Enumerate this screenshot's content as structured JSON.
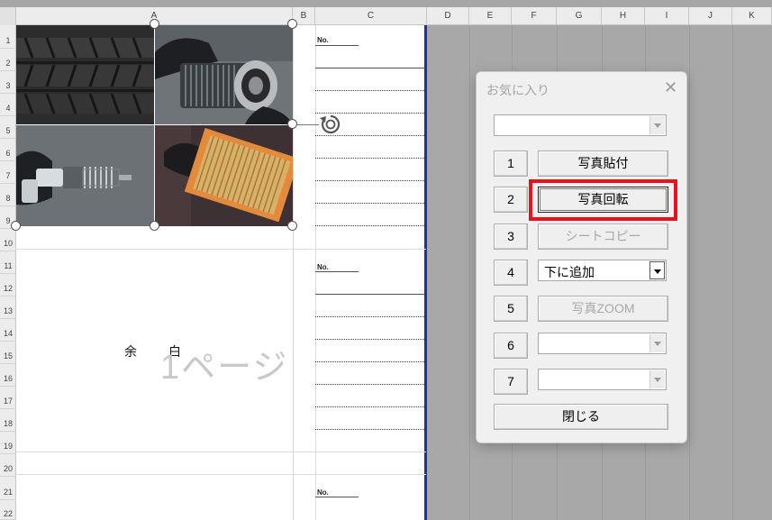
{
  "spreadsheet": {
    "columns": [
      "A",
      "B",
      "C",
      "D",
      "E",
      "F",
      "G",
      "H",
      "I",
      "J",
      "K"
    ],
    "rows": [
      "1",
      "2",
      "3",
      "4",
      "5",
      "6",
      "7",
      "8",
      "9",
      "10",
      "11",
      "12",
      "13",
      "14",
      "15",
      "16",
      "17",
      "18",
      "19",
      "20",
      "21",
      "22"
    ],
    "no_labels": [
      "No.",
      "No.",
      "No."
    ],
    "memo_chars": [
      "余",
      "白"
    ],
    "page_watermark": "1ページ"
  },
  "dialog": {
    "title": "お気に入り",
    "close_icon": "close-icon",
    "top_combo_value": "",
    "rows": [
      {
        "num": "1",
        "kind": "button",
        "label": "写真貼付",
        "enabled": true
      },
      {
        "num": "2",
        "kind": "button",
        "label": "写真回転",
        "enabled": true,
        "focused": true
      },
      {
        "num": "3",
        "kind": "button",
        "label": "シートコピー",
        "enabled": false
      },
      {
        "num": "4",
        "kind": "combo",
        "value": "下に追加",
        "enabled": true
      },
      {
        "num": "5",
        "kind": "button",
        "label": "写真ZOOM",
        "enabled": false
      },
      {
        "num": "6",
        "kind": "combo",
        "value": "",
        "enabled": false
      },
      {
        "num": "7",
        "kind": "combo",
        "value": "",
        "enabled": false
      }
    ],
    "close_button_label": "閉じる"
  },
  "colors": {
    "highlight": "#e8121b",
    "page_border": "#1a2fb8"
  }
}
